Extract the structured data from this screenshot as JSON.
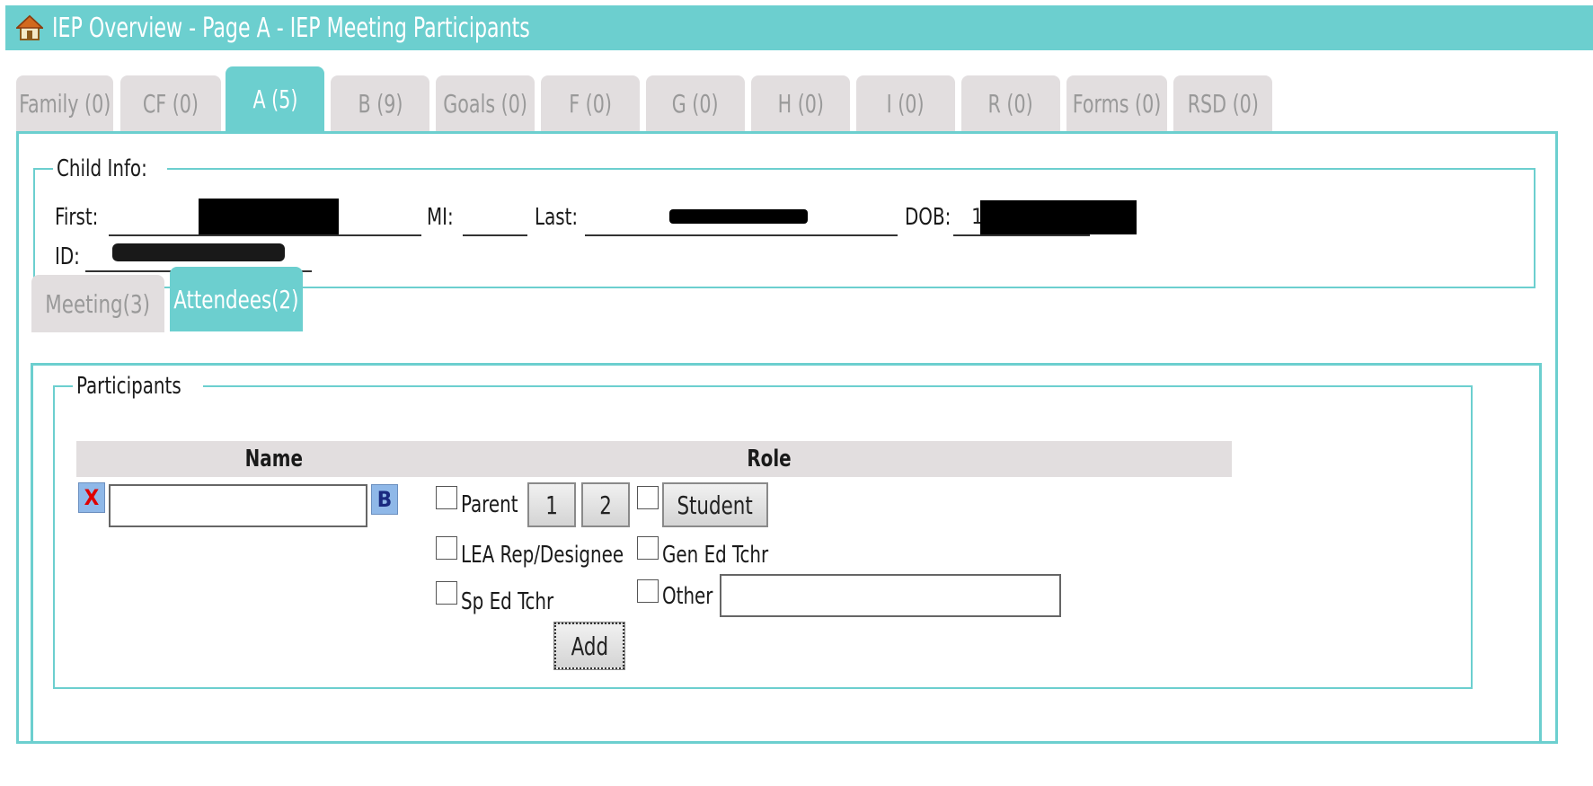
{
  "title": "IEP Overview - Page A - IEP Meeting Participants",
  "tabs": [
    "Family (0)",
    "CF (0)",
    "A (5)",
    "B (9)",
    "Goals (0)",
    "F (0)",
    "G (0)",
    "H (0)",
    "I (0)",
    "R (0)",
    "Forms (0)",
    "RSD (0)"
  ],
  "active_tab": "A (5)",
  "child_info": {
    "legend": "Child Info:",
    "first_label": "First:",
    "mi_label": "MI:",
    "last_label": "Last:",
    "dob_label": "DOB:",
    "id_label": "ID:",
    "dob_prefix": "1"
  },
  "subtabs": [
    "Meeting(3)",
    "Attendees(2)"
  ],
  "active_subtab": "Attendees(2)",
  "participants": {
    "legend": "Participants",
    "col_name": "Name",
    "col_role": "Role",
    "remove_btn": "X",
    "browse_btn": "B",
    "name_value": "",
    "roles": {
      "parent": "Parent",
      "parent_btn1": "1",
      "parent_btn2": "2",
      "student": "Student",
      "lea": "LEA Rep/Designee",
      "gen_ed": "Gen Ed Tchr",
      "sp_ed": "Sp Ed Tchr",
      "other": "Other",
      "other_value": ""
    },
    "add_btn": "Add"
  },
  "colors": {
    "accent": "#6ccfcf",
    "tab_inactive": "#e2dedf",
    "remove_red": "#e00000",
    "browse_blue": "#8fb8e8"
  }
}
